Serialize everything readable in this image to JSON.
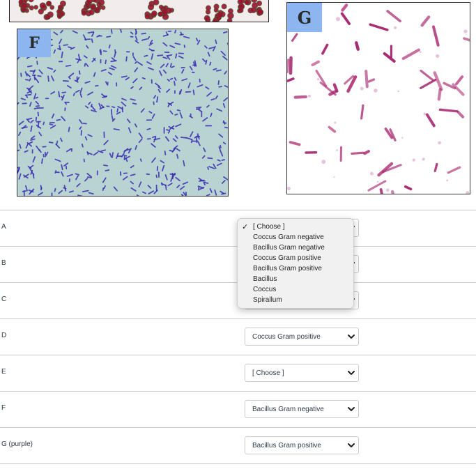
{
  "images": {
    "f": {
      "label": "F",
      "stain_color": "#3a2fb0",
      "background_color": "#b9d3d3"
    },
    "g": {
      "label": "G",
      "stain_color": "#a6216b",
      "background_color": "#ffffff"
    },
    "top_cropped": {
      "stain_color": "#9b1230"
    }
  },
  "questions": [
    {
      "label": "A",
      "selected": "[ Choose ]"
    },
    {
      "label": "B",
      "selected": "[ Choose ]"
    },
    {
      "label": "C",
      "selected": "[ Choose ]"
    },
    {
      "label": "D",
      "selected": "Coccus Gram positive"
    },
    {
      "label": "E",
      "selected": "[ Choose ]"
    },
    {
      "label": "F",
      "selected": "Bacillus Gram negative"
    },
    {
      "label": "G (purple)",
      "selected": "Bacillus Gram positive"
    }
  ],
  "dropdown": {
    "open_for": "A",
    "checked_option": "[ Choose ]",
    "options": [
      "[ Choose ]",
      "Coccus Gram negative",
      "Bacillus Gram negative",
      "Coccus Gram positive",
      "Bacillus Gram positive",
      "Bacillus",
      "Coccus",
      "Spirallum"
    ]
  },
  "icons": {
    "checkmark": "✓",
    "chevron": "chevron-down-icon"
  }
}
